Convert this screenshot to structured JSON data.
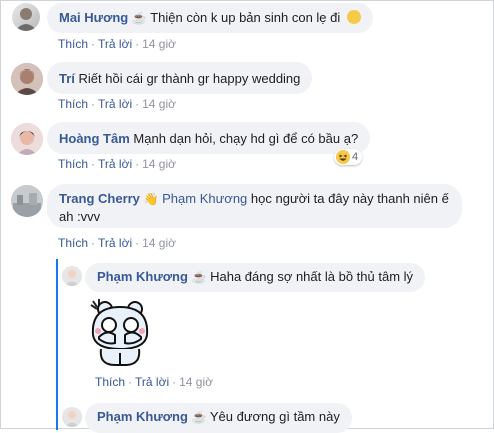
{
  "comments": [
    {
      "author": "Mai Hương",
      "text": "Thiện còn k up bản sinh con lẹ đi",
      "actions": {
        "like": "Thích",
        "reply": "Trả lời",
        "time": "14 giờ"
      }
    },
    {
      "author": "Trí",
      "text": "Riết hồi cái gr thành gr happy wedding",
      "actions": {
        "like": "Thích",
        "reply": "Trả lời",
        "time": "14 giờ"
      }
    },
    {
      "author": "Hoàng Tâm",
      "text": "Mạnh dạn hỏi, chạy hd gì để có bầu ạ?",
      "reaction_count": "4",
      "actions": {
        "like": "Thích",
        "reply": "Trả lời",
        "time": "14 giờ"
      }
    },
    {
      "author": "Trang Cherry",
      "mention": "Phạm Khương",
      "text_line1": "học người ta đây này thanh niên ế",
      "text_line2": "ah :vvv",
      "actions": {
        "like": "Thích",
        "reply": "Trả lời",
        "time": "14 giờ"
      }
    }
  ],
  "replies": [
    {
      "author": "Phạm Khương",
      "text": "Haha đáng sợ nhất là bồ thủ tâm lý",
      "actions": {
        "like": "Thích",
        "reply": "Trả lời",
        "time": "14 giờ"
      }
    },
    {
      "author": "Phạm Khương",
      "text": "Yêu đương gì tầm này"
    }
  ],
  "colors": {
    "link": "#385898",
    "bubble": "#f0f2f5",
    "thread_line": "#1877f2"
  }
}
